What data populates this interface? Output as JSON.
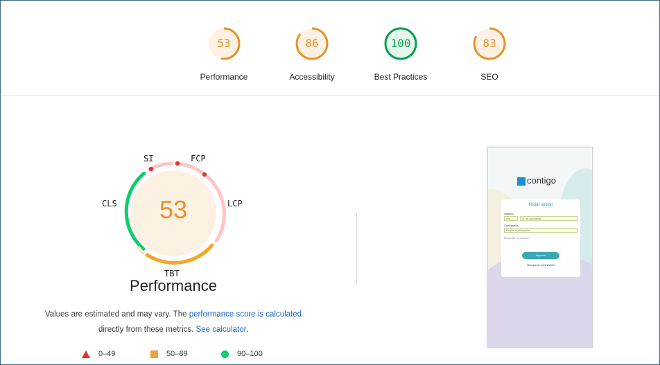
{
  "gauges": [
    {
      "score": "53",
      "label": "Performance",
      "color": "#e8922a",
      "bg": "#fdf1e3",
      "fraction": 0.53
    },
    {
      "score": "86",
      "label": "Accessibility",
      "color": "#e8922a",
      "bg": "#fdf1e3",
      "fraction": 0.86
    },
    {
      "score": "100",
      "label": "Best Practices",
      "color": "#0a9e4e",
      "bg": "#e6f6ec",
      "fraction": 1.0
    },
    {
      "score": "83",
      "label": "SEO",
      "color": "#e8922a",
      "bg": "#fdf1e3",
      "fraction": 0.83
    }
  ],
  "performance": {
    "score": "53",
    "title": "Performance",
    "metrics": {
      "si": "SI",
      "fcp": "FCP",
      "lcp": "LCP",
      "tbt": "TBT",
      "cls": "CLS"
    },
    "note_before": "Values are estimated and may vary. The ",
    "note_link1": "performance score is calculated",
    "note_mid": "directly from these metrics. ",
    "note_link2": "See calculator."
  },
  "legend": [
    {
      "range": "0–49",
      "shape": "triangle",
      "color": "#e8302c"
    },
    {
      "range": "50–89",
      "shape": "square",
      "color": "#f2a03a"
    },
    {
      "range": "90–100",
      "shape": "circle",
      "color": "#0cce6b"
    }
  ],
  "screenshot": {
    "logo": "contigo",
    "card_title": "Iniciar sesión",
    "user_label": "Usuario",
    "user_select": "DNI",
    "user_placeholder": "N° de documento",
    "pass_label": "Contraseña",
    "pass_placeholder": "Escribe tu contraseña",
    "remember": "Recordar mi usuario",
    "button": "Ingresar",
    "forgot": "Recuperar contraseña"
  },
  "colors": {
    "accent_link": "#1a67d2",
    "average": "#e8922a",
    "pass": "#0a9e4e",
    "fail": "#e8302c"
  }
}
